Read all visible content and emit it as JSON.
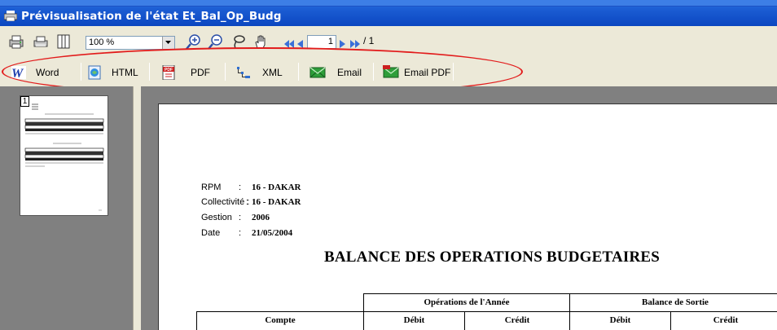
{
  "window": {
    "title": "Prévisualisation de l'état Et_Bal_Op_Budg"
  },
  "toolbar": {
    "zoom_value": "100 %",
    "page_current": "1",
    "page_total": "/ 1",
    "icons": [
      "print-setup-icon",
      "print-icon",
      "columns-icon",
      "zoom-in-icon",
      "zoom-out-icon",
      "lasso-icon",
      "hand-icon",
      "first-page-icon",
      "prev-page-icon",
      "next-page-icon",
      "last-page-icon"
    ]
  },
  "export_bar": {
    "word_label": "Word",
    "html_label": "HTML",
    "pdf_label": "PDF",
    "xml_label": "XML",
    "email_label": "Email",
    "email_pdf_label": "Email PDF"
  },
  "thumbnail": {
    "page_number": "1"
  },
  "report": {
    "info": [
      {
        "label": "RPM",
        "colon": ":",
        "value": "16 - DAKAR"
      },
      {
        "label": "Collectivité :",
        "colon": ":",
        "value": "16 - DAKAR"
      },
      {
        "label": "Gestion",
        "colon": ":",
        "value": "2006"
      },
      {
        "label": "Date",
        "colon": ":",
        "value": "21/05/2004"
      }
    ],
    "title": "BALANCE DES OPERATIONS BUDGETAIRES",
    "table": {
      "group_headers": [
        "Opérations de l'Année",
        "Balance de Sortie"
      ],
      "columns": [
        "Compte",
        "Débit",
        "Crédit",
        "Débit",
        "Crédit"
      ]
    }
  },
  "colors": {
    "titlebar": "#0b46c0",
    "annotation_ellipse": "#e21b1b",
    "preview_background": "#808080"
  }
}
